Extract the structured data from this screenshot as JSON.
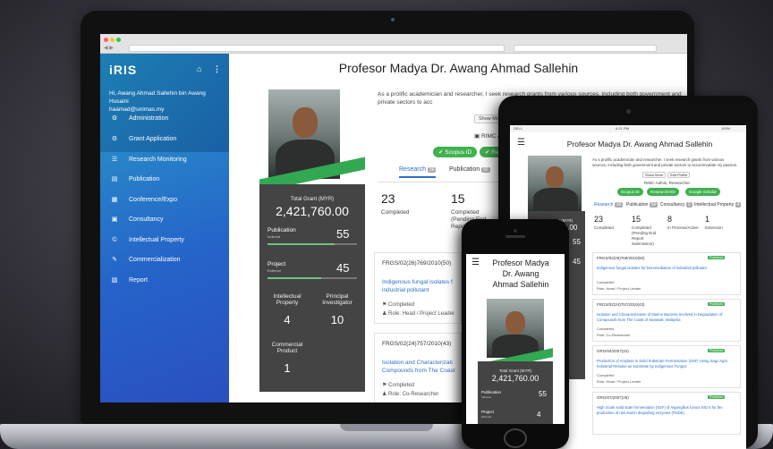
{
  "app": {
    "logo": "iRIS"
  },
  "sidebar": {
    "greeting": "Hi, Awang Ahmad Sallehin bin Awang Husaini",
    "email": "haamad@unimas.my",
    "items": [
      {
        "label": "Administration",
        "icon": "gear-icon",
        "glyph": "⚙"
      },
      {
        "label": "Grant Application",
        "icon": "settings-icon",
        "glyph": "⚙"
      },
      {
        "label": "Research Monitoring",
        "icon": "list-icon",
        "glyph": "☰"
      },
      {
        "label": "Publication",
        "icon": "book-icon",
        "glyph": "▤"
      },
      {
        "label": "Conference/Expo",
        "icon": "calendar-icon",
        "glyph": "▦"
      },
      {
        "label": "Consultancy",
        "icon": "briefcase-icon",
        "glyph": "▣"
      },
      {
        "label": "Intellectual Property",
        "icon": "copyright-icon",
        "glyph": "©"
      },
      {
        "label": "Commercialization",
        "icon": "wrench-icon",
        "glyph": "✎"
      },
      {
        "label": "Report",
        "icon": "report-icon",
        "glyph": "▧"
      }
    ]
  },
  "profile": {
    "name": "Profesor Madya Dr. Awang Ahmad Sallehin",
    "phone_name_lines": [
      "Profesor Madya",
      "Dr. Awang",
      "Ahmad Sallehin"
    ],
    "bio": "As a prolific academician and researcher, I seek research grants from various sources, including both government and private sectors to acc",
    "show_more": "Show Mo",
    "role": "RIMC Adm",
    "badges": [
      "Scopus ID",
      "Rese"
    ],
    "tablet_bio": "As a prolific academician and researcher, I seek research grants from various sources, including both government and private sectors to accommodate my passion.",
    "tablet_buttons": [
      "Show More",
      "Edit Profile"
    ],
    "tablet_role": "RIMC Admin, Researcher",
    "tablet_badges": [
      "Scopus ID",
      "ResearcherID",
      "Google Scholar"
    ]
  },
  "grant": {
    "label": "Total Grant (MYR)",
    "value": "2,421,760.00",
    "publication_label": "Publication",
    "publication_sub": "Indexed",
    "publication_value": "55",
    "publication_progress": 0.75,
    "project_label": "Project",
    "project_sub": "External",
    "project_value": "45",
    "project_progress": 0.6,
    "ip_label": "Intellectual Property",
    "ip_value": "4",
    "pi_label": "Principal Investigator",
    "pi_value": "10",
    "commercial_label": "Commercial Product",
    "commercial_value": "1"
  },
  "tabs": {
    "research": "Research",
    "research_count": "36",
    "publication": "Publication",
    "publication_count": "56",
    "consultancy": "Consultancy",
    "consultancy_count": "0",
    "ip": "Intellectual Property",
    "ip_count": "4"
  },
  "stats": [
    {
      "num": "23",
      "label": "Completed"
    },
    {
      "num": "15",
      "label": "Completed (Pending End Report Submission)"
    },
    {
      "num": "8",
      "label": "In Process/Active"
    },
    {
      "num": "1",
      "label": "Extension"
    }
  ],
  "laptop_stats": [
    {
      "num": "23",
      "label": "Completed"
    },
    {
      "num": "15",
      "label": "Completed (Pending End Repo Sub"
    }
  ],
  "projects": [
    {
      "code": "FRGS/02(26)769/2010(50)",
      "title": "Indigenous fungal isolates for bioremediation of industrial pollutant",
      "status": "Completed",
      "role": "Role: Head / Project Leader"
    },
    {
      "code": "FRGS/02(24)757/2010(43)",
      "title": "Isolation and Characterization of Marine Bacteria Involved in Degradation of Compounds from The Coast of Sarawak, Malaysia",
      "status": "Completed",
      "role": "Role: Co-Researcher"
    }
  ],
  "laptop_projects": [
    {
      "code": "FRGS/02(26)769/2010(50)",
      "title": "Indigenous fungal isolates f industrial pollutant",
      "status": "Completed",
      "role": "Role: Head / Project Leader"
    },
    {
      "code": "FRGS/02(24)757/2010(43)",
      "title": "Isolation and Characterizati Compounds from The Coast",
      "status": "Completed",
      "role": "Role: Co-Researcher"
    }
  ],
  "tablet_projects": [
    {
      "code": "FRGS/02(26)769/2010(50)",
      "title": "Indigenous fungal isolates for bioremediation of industrial pollutant",
      "status": "Completed",
      "role": "Role: Head / Project Leader"
    },
    {
      "code": "FRGS/02(24)757/2010(43)",
      "title": "Isolation and Characterization of Marine Bacteria Involved in Degradation of Compounds from The Coast of Sarawak, Malaysia",
      "status": "Completed",
      "role": "Role: Co-Researcher"
    },
    {
      "code": "GRG/04/2007(24)",
      "title": "Production of Amylase in Solid Substrate Fermentation (SSF) Using Sago Agro Industrial Residue as Substrate by Indigenous Fungus",
      "status": "Completed",
      "role": "Role: Head / Project Leader"
    },
    {
      "code": "GRG/07/2007(25)",
      "title": "High Scale solid state fermentation (SSF) of Aspergillus fumus NIO 6 for the production of raw starch degrading enzymes (RSDE)",
      "status": "",
      "role": ""
    }
  ],
  "tablet_status": {
    "carrier": "DELL",
    "time": "4:21 PM",
    "battery": "100%"
  },
  "tablet_badge": "Published",
  "phone": {
    "grant_label": "Total Grant (MYR)",
    "grant_value": "2,421,760.00",
    "publication": "Publication",
    "publication_sub": "Indexed",
    "publication_value": "55",
    "project": "Project",
    "project_sub": "External",
    "project_value": "4"
  },
  "colors": {
    "accent_green": "#3fb14f",
    "link_blue": "#2a70c9",
    "sidebar_blue": "#2563c9",
    "card_dark": "#444444"
  }
}
